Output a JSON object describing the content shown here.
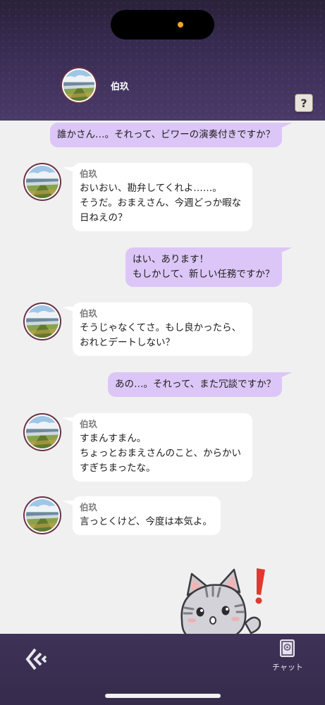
{
  "header": {
    "contact_name": "伯玖",
    "help_label": "?"
  },
  "messages": [
    {
      "from": "me",
      "lines": [
        "誰かさん…。それって、ビワーの演奏付きですか？"
      ]
    },
    {
      "from": "other",
      "sender": "伯玖",
      "lines": [
        "おいおい、勘弁してくれよ……。",
        "そうだ。おまえさん、今週どっか暇な",
        "日ねえの？"
      ]
    },
    {
      "from": "me",
      "lines": [
        "はい、あります！",
        "もしかして、新しい任務ですか？"
      ]
    },
    {
      "from": "other",
      "sender": "伯玖",
      "lines": [
        "そうじゃなくてさ。もし良かったら、",
        "おれとデートしない？"
      ]
    },
    {
      "from": "me",
      "lines": [
        "あの…。それって、また冗談ですか？"
      ]
    },
    {
      "from": "other",
      "sender": "伯玖",
      "lines": [
        "すまんすまん。",
        "ちょっとおまえさんのこと、からかい",
        "すぎちまったな。"
      ]
    },
    {
      "from": "other",
      "sender": "伯玖",
      "lines": [
        "言っとくけど、今度は本気よ。"
      ]
    }
  ],
  "footer": {
    "chat_label": "チャット"
  },
  "icons": {
    "back": "back-chevrons-icon",
    "chat": "chat-book-icon",
    "help": "question-icon",
    "mascot": "cat-exclamation-icon"
  },
  "colors": {
    "header_bg": "#3a2d55",
    "my_bubble": "#dcc6f7",
    "other_bubble": "#ffffff",
    "chat_bg": "#f0f0f0",
    "exclamation": "#e0392f"
  }
}
